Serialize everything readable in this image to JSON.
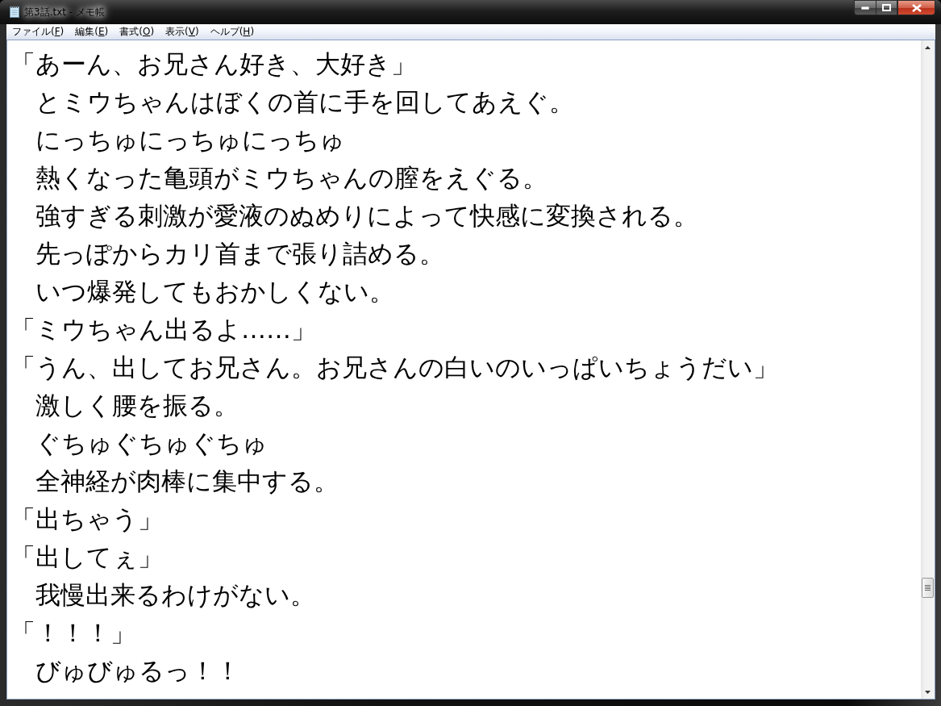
{
  "window": {
    "title": "第3話.txt - メモ帳"
  },
  "menu": [
    {
      "text_before": "ファイル(",
      "access_key": "F",
      "text_after": ")"
    },
    {
      "text_before": "編集(",
      "access_key": "E",
      "text_after": ")"
    },
    {
      "text_before": "書式(",
      "access_key": "O",
      "text_after": ")"
    },
    {
      "text_before": "表示(",
      "access_key": "V",
      "text_after": ")"
    },
    {
      "text_before": "ヘルプ(",
      "access_key": "H",
      "text_after": ")"
    }
  ],
  "document": {
    "lines": [
      "「あーん、お兄さん好き、大好き」",
      "　とミウちゃんはぼくの首に手を回してあえぐ。",
      "　にっちゅにっちゅにっちゅ",
      "　熱くなった亀頭がミウちゃんの膣をえぐる。",
      "　強すぎる刺激が愛液のぬめりによって快感に変換される。",
      "　先っぽからカリ首まで張り詰める。",
      "　いつ爆発してもおかしくない。",
      "「ミウちゃん出るよ……」",
      "「うん、出してお兄さん。お兄さんの白いのいっぱいちょうだい」",
      "　激しく腰を振る。",
      "　ぐちゅぐちゅぐちゅ",
      "　全神経が肉棒に集中する。",
      "「出ちゃう」",
      "「出してぇ」",
      "　我慢出来るわけがない。",
      "「！！！」",
      "　びゅびゅるっ！！"
    ]
  }
}
